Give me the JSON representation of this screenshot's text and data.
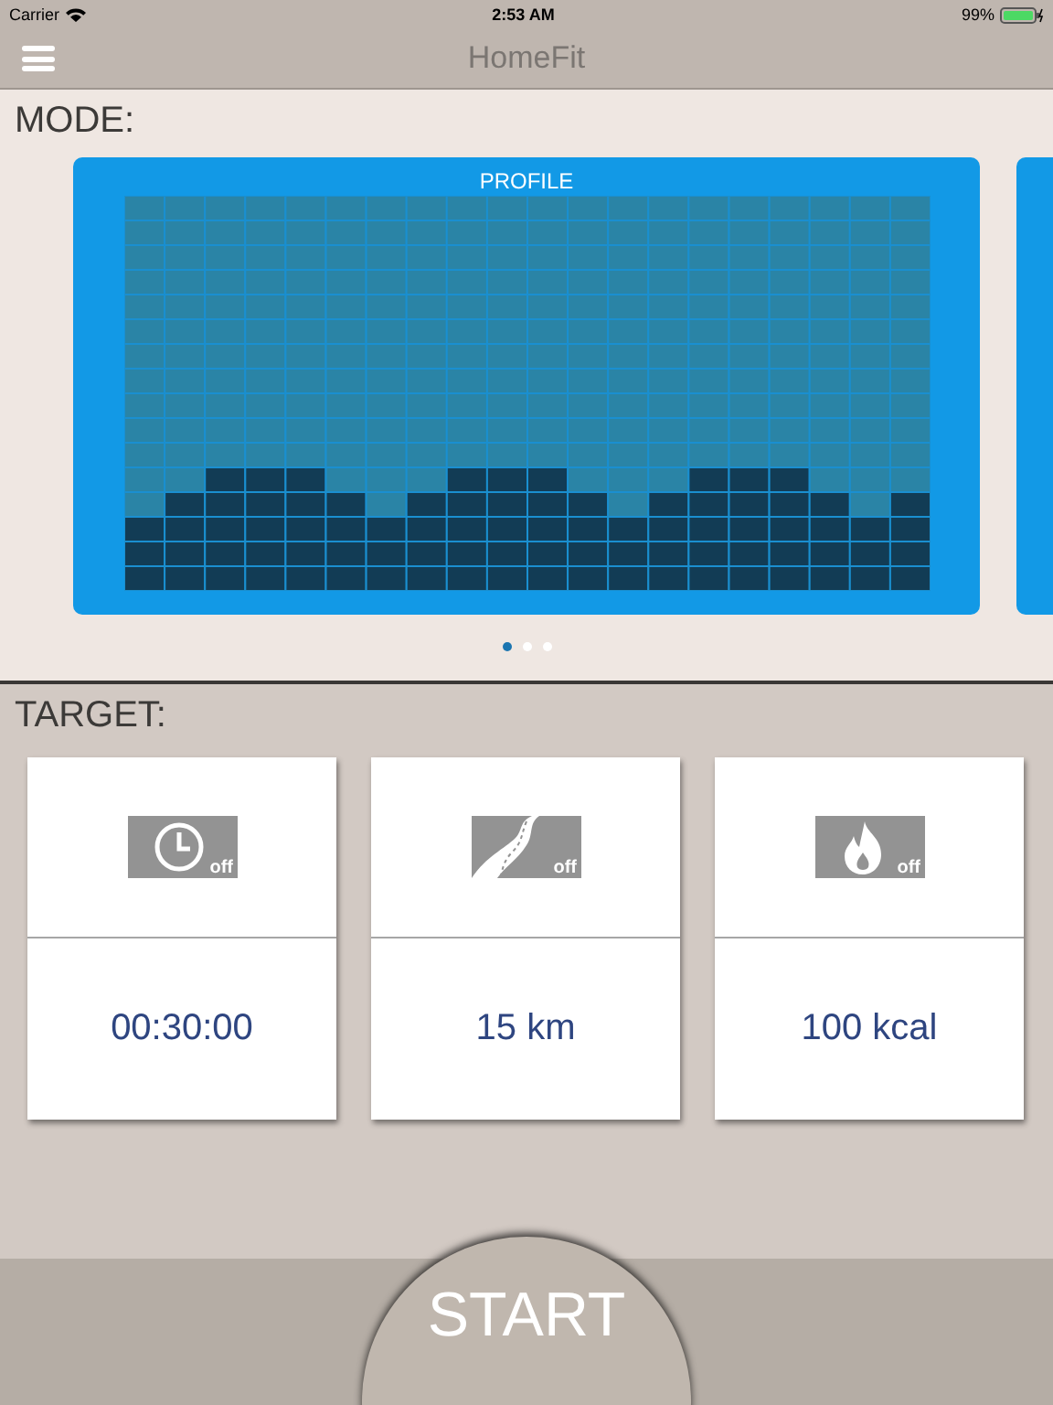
{
  "status_bar": {
    "carrier": "Carrier",
    "time": "2:53 AM",
    "battery": "99%"
  },
  "nav": {
    "title": "HomeFit"
  },
  "mode": {
    "heading": "MODE:",
    "cards": [
      {
        "label": "PROFILE"
      }
    ],
    "pages": [
      {
        "selected": true
      },
      {
        "selected": false
      },
      {
        "selected": false
      }
    ]
  },
  "target": {
    "heading": "TARGET:",
    "items": [
      {
        "kind": "time",
        "badge": "off",
        "value": "00:30:00"
      },
      {
        "kind": "distance",
        "badge": "off",
        "value": "15 km"
      },
      {
        "kind": "calories",
        "badge": "off",
        "value": "100 kcal"
      }
    ]
  },
  "start_button": "START"
}
